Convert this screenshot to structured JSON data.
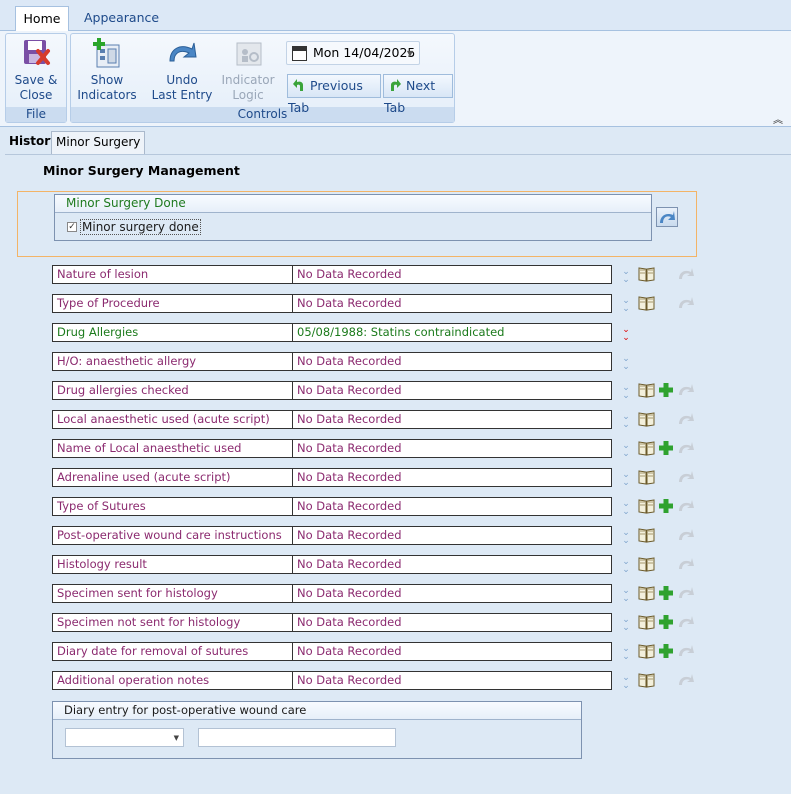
{
  "ribbon": {
    "tabs": [
      "Home",
      "Appearance"
    ],
    "groups": {
      "file": {
        "label": "File",
        "save_close": [
          "Save &",
          "Close"
        ]
      },
      "controls": {
        "label": "Controls",
        "show_indicators": [
          "Show",
          "Indicators"
        ],
        "undo_last_entry": [
          "Undo",
          "Last Entry"
        ],
        "indicator_logic": [
          "Indicator",
          "Logic"
        ],
        "date": "Mon 14/04/2025",
        "previous_tab": "Previous Tab",
        "next_tab": "Next Tab"
      }
    }
  },
  "doc_tabs": {
    "history": "History",
    "minor_surgery": "Minor Surgery"
  },
  "page": {
    "title": "Minor Surgery Management",
    "done_box": {
      "header": "Minor Surgery Done",
      "checkbox_label": "Minor surgery done",
      "checked": true
    }
  },
  "rows": [
    {
      "label": "Nature of lesion",
      "value": "No Data Recorded",
      "actions": [
        "chevron",
        "book",
        "undo"
      ]
    },
    {
      "label": "Type of Procedure",
      "value": "No Data Recorded",
      "actions": [
        "chevron",
        "book",
        "undo"
      ]
    },
    {
      "label": "Drug Allergies",
      "value": "05/08/1988: Statins contraindicated",
      "highlight": "green",
      "actions": [
        "chevron-red"
      ]
    },
    {
      "label": "H/O: anaesthetic allergy",
      "value": "No Data Recorded",
      "actions": [
        "chevron"
      ]
    },
    {
      "label": "Drug allergies checked",
      "value": "No Data Recorded",
      "actions": [
        "chevron",
        "book",
        "plus",
        "undo"
      ]
    },
    {
      "label": "Local anaesthetic used (acute script)",
      "value": "No Data Recorded",
      "actions": [
        "chevron",
        "book",
        "undo"
      ]
    },
    {
      "label": "Name of Local anaesthetic used",
      "value": "No Data Recorded",
      "actions": [
        "chevron",
        "book",
        "plus",
        "undo"
      ]
    },
    {
      "label": "Adrenaline used (acute script)",
      "value": "No Data Recorded",
      "actions": [
        "chevron",
        "book",
        "undo"
      ]
    },
    {
      "label": "Type of Sutures",
      "value": "No Data Recorded",
      "actions": [
        "chevron",
        "book",
        "plus",
        "undo"
      ]
    },
    {
      "label": "Post-operative wound care instructions",
      "value": "No Data Recorded",
      "actions": [
        "chevron",
        "book",
        "undo"
      ]
    },
    {
      "label": "Histology result",
      "value": "No Data Recorded",
      "actions": [
        "chevron",
        "book",
        "undo"
      ]
    },
    {
      "label": "Specimen sent for histology",
      "value": "No Data Recorded",
      "actions": [
        "chevron",
        "book",
        "plus",
        "undo"
      ]
    },
    {
      "label": "Specimen not sent for histology",
      "value": "No Data Recorded",
      "actions": [
        "chevron",
        "book",
        "plus",
        "undo"
      ]
    },
    {
      "label": "Diary date for removal of sutures",
      "value": "No Data Recorded",
      "actions": [
        "chevron",
        "book",
        "plus",
        "undo"
      ]
    },
    {
      "label": "Additional operation notes",
      "value": "No Data Recorded",
      "actions": [
        "chevron",
        "book",
        "undo"
      ]
    }
  ],
  "diary": {
    "header": "Diary entry for post-operative wound care",
    "select_value": "",
    "text_value": ""
  },
  "colors": {
    "label_text": "#8b2a6f",
    "highlight_green": "#1b7a1b",
    "accent_blue": "#1e4a8a",
    "group_border": "#f3b467"
  }
}
